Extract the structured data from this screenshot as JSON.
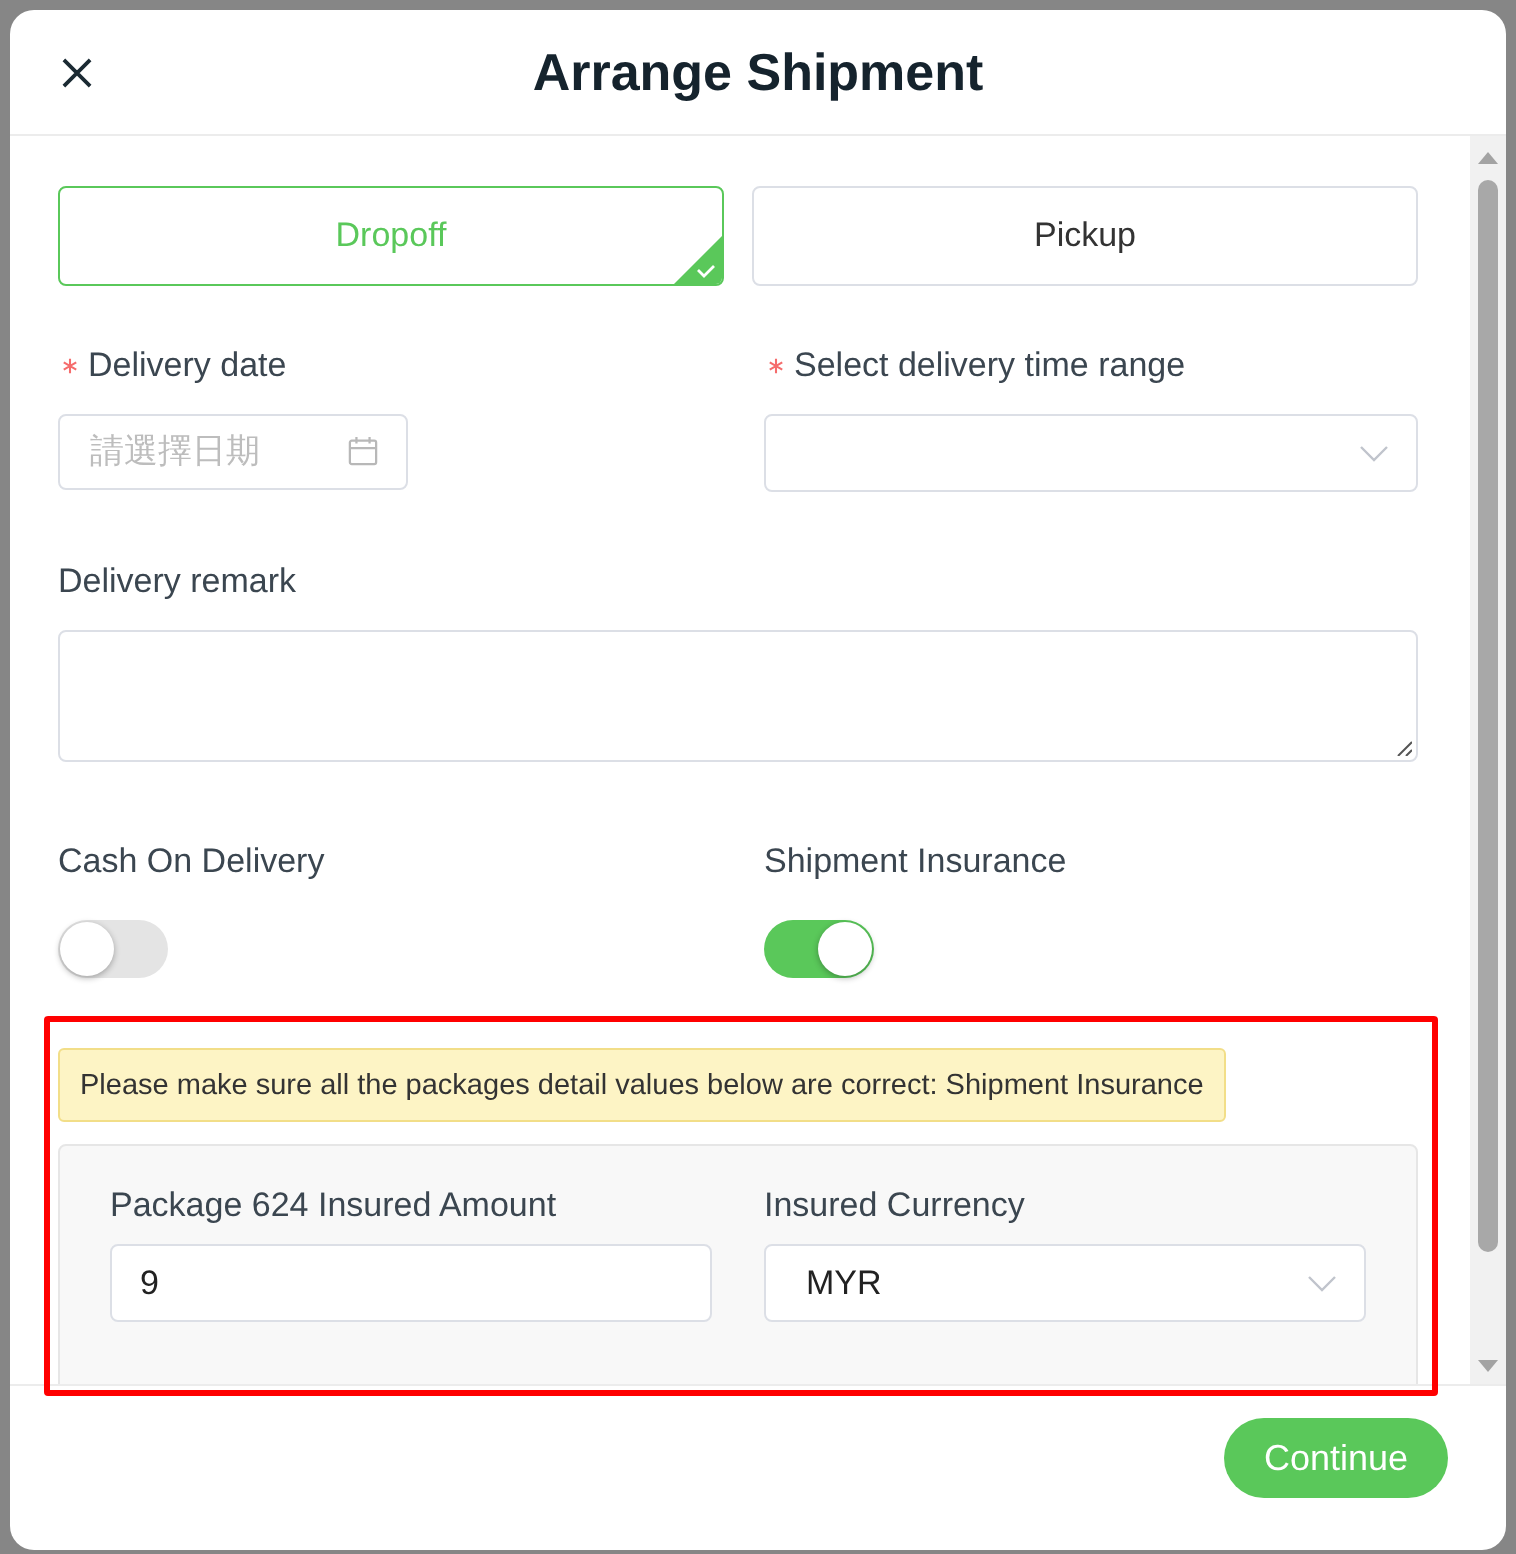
{
  "dialog": {
    "title": "Arrange Shipment"
  },
  "delivery_methods": [
    {
      "label": "Dropoff",
      "selected": true
    },
    {
      "label": "Pickup",
      "selected": false
    }
  ],
  "delivery_date": {
    "label": "Delivery date",
    "required": true,
    "placeholder": "請選擇日期"
  },
  "time_range": {
    "label": "Select delivery time range",
    "required": true
  },
  "remark": {
    "label": "Delivery remark"
  },
  "toggles": [
    {
      "label": "Cash On Delivery",
      "on": false
    },
    {
      "label": "Shipment Insurance",
      "on": true
    }
  ],
  "insurance_section": {
    "highlighted": true,
    "notice": "Please make sure all the packages detail values below are correct: Shipment Insurance",
    "packages": [
      {
        "amount_label": "Package 624 Insured Amount",
        "amount": "9",
        "currency_label": "Insured Currency",
        "currency": "MYR"
      }
    ]
  },
  "footer": {
    "continue_button": "Continue"
  }
}
